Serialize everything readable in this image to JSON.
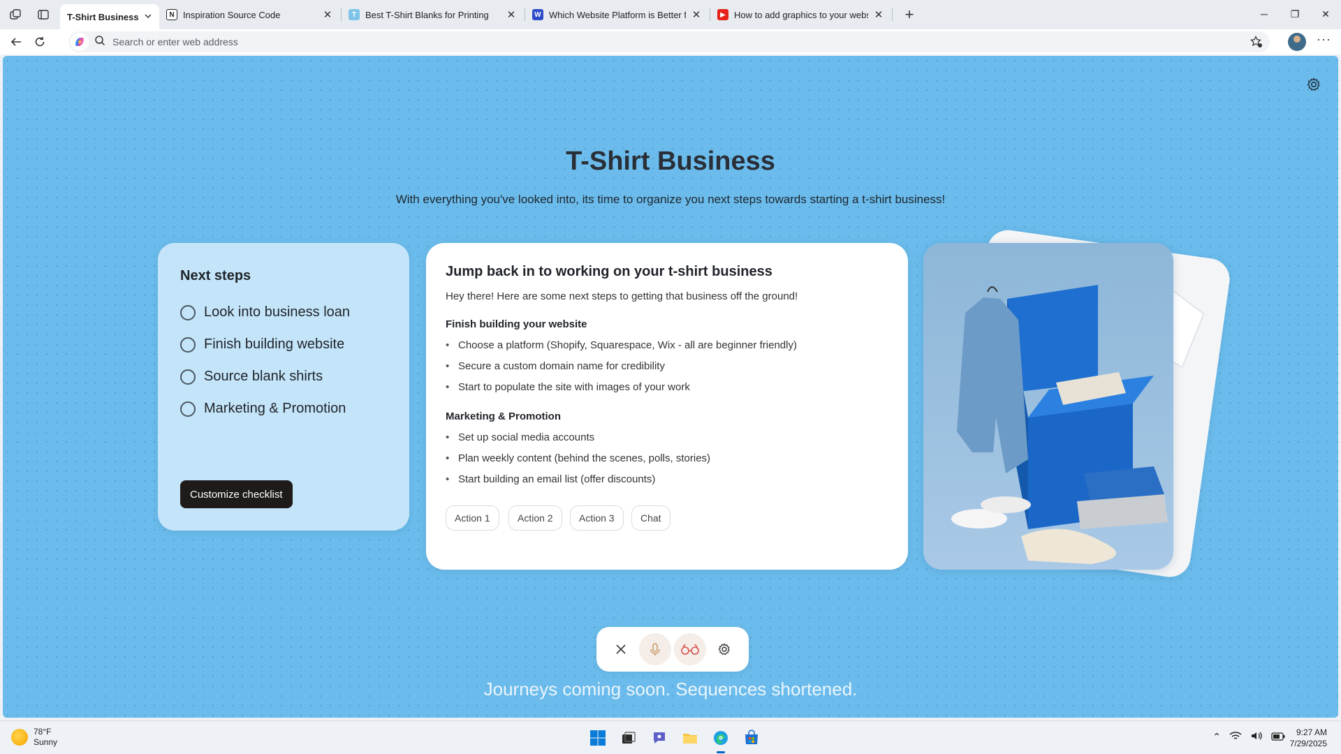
{
  "browser": {
    "tabs": [
      {
        "title": "T-Shirt Business",
        "active": true
      },
      {
        "title": "Inspiration Source Code",
        "favicon": "notion"
      },
      {
        "title": "Best T-Shirt Blanks for Printing",
        "favicon": "shirt"
      },
      {
        "title": "Which Website Platform is Better fo",
        "favicon": "platform"
      },
      {
        "title": "How to add graphics to your websit",
        "favicon": "youtube"
      }
    ],
    "address_placeholder": "Search or enter web address"
  },
  "page": {
    "title": "T-Shirt Business",
    "subtitle": "With everything you've looked into, its time to organize you next steps towards starting a t-shirt business!",
    "next_steps": {
      "title": "Next steps",
      "items": [
        "Look into business loan",
        "Finish building website",
        "Source blank shirts",
        "Marketing & Promotion"
      ],
      "button": "Customize checklist"
    },
    "card": {
      "title": "Jump back in to working on your t-shirt business",
      "intro": "Hey there! Here are some next steps to getting that business off the ground!",
      "sections": [
        {
          "heading": "Finish building your website",
          "items": [
            "Choose a platform (Shopify, Squarespace, Wix - all are beginner friendly)",
            "Secure a custom domain name for credibility",
            "Start to populate the site with images of your work"
          ]
        },
        {
          "heading": "Marketing & Promotion",
          "items": [
            "Set up social media accounts",
            "Plan weekly content (behind the scenes, polls, stories)",
            "Start building an email list (offer discounts)"
          ]
        }
      ],
      "actions": [
        "Action 1",
        "Action 2",
        "Action 3",
        "Chat"
      ]
    },
    "status_text": "Journeys coming soon. Sequences shortened."
  },
  "taskbar": {
    "weather_temp": "78°F",
    "weather_desc": "Sunny",
    "time": "9:27 AM",
    "date": "7/29/2025"
  },
  "colors": {
    "background": "#6bbcec",
    "next_card": "#c4e5f9",
    "button_dark": "#1f1b1b"
  }
}
